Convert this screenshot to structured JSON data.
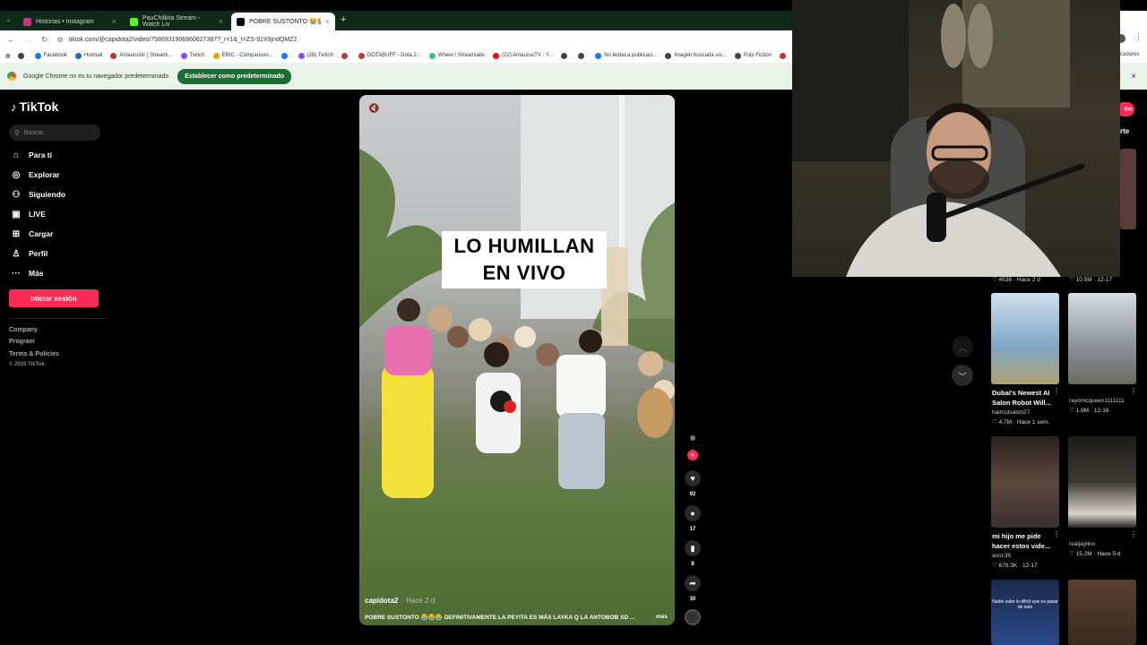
{
  "browser": {
    "tabs": [
      {
        "label": "Historias • Instagram",
        "color": "#c13584"
      },
      {
        "label": "PauChilkita Stream - Watch Liv",
        "color": "#53fc18"
      },
      {
        "label": "POBRE SUSTONTO 😭😭😭 D",
        "color": "#000000"
      }
    ],
    "url": "tiktok.com/@capidota2/video/7586931906860627387?_r=1&_t=ZS-92X9jndQMZ2",
    "bookmarks": [
      "Facebook",
      "Hotmail",
      "Antaurustv | Streami...",
      "Twitch",
      "ERIC - Comparison...",
      "(28) Twitch",
      "DOTABUFF - Dota 2...",
      "Wheel / Streamlabs",
      "(22) AntaurusTV - Y...",
      "No leídaLa publicaci...",
      "Imagen buscada vis...",
      "Pulp Fiction"
    ],
    "bookmarks_right": "cadores",
    "infobar_text": "Google Chrome no es tu navegador predeterminado",
    "set_default_label": "Establecer como predeterminado"
  },
  "tiktok": {
    "logo": "TikTok",
    "search_placeholder": "Buscar",
    "nav": [
      "Para ti",
      "Explorar",
      "Siguiendo",
      "LIVE",
      "Cargar",
      "Perfil",
      "Más"
    ],
    "login_label": "Iniciar sesión",
    "footer": [
      "Company",
      "Program",
      "Terms & Policies"
    ],
    "copyright": "© 2025 TikTok",
    "video": {
      "caption_line1": "LO HUMILLAN",
      "caption_line2": "EN VIVO",
      "author": "capidota2",
      "time": "· Hace 2 d",
      "description": "POBRE SUSTONTO 😭😭😭 DEFINITIVAMENTE LA PEYITA ES MÁS LAYKA Q LA ANTOBOB XD ...",
      "more": "más"
    },
    "actions": {
      "likes": "92",
      "comments": "17",
      "saves": "8",
      "shares": "30"
    }
  },
  "right_column": {
    "partial_top": {
      "left_stat": "♡ 4536 · Hace 2 d",
      "right_stat": "♡ 10.5M · 12-17",
      "partial_label_1": "ón",
      "partial_label_2": "rte"
    },
    "items": [
      {
        "title": "Dubai's Newest AI Salon Robot Will...",
        "author": "haircutsalon27",
        "stat": "♡ 4.7M · Hace 1 sem.",
        "color": "#7fa6c4"
      },
      {
        "title": "",
        "author": "rayomcqueen1111111",
        "stat": "♡ 1.9M · 12-16",
        "color": "#8a8f96"
      },
      {
        "title": "mi hijo me pide hacer estos vide...",
        "author": "anst.95",
        "stat": "♡ 678.3K · 12-17",
        "color": "#5c4a3f"
      },
      {
        "title": "",
        "author": "realjaylinn",
        "stat": "♡ 15.2M · Hace 5 d",
        "color": "#3d3a35"
      }
    ],
    "bottom_caption": "Nadie sabe lo difícil que es pasar de esto"
  }
}
